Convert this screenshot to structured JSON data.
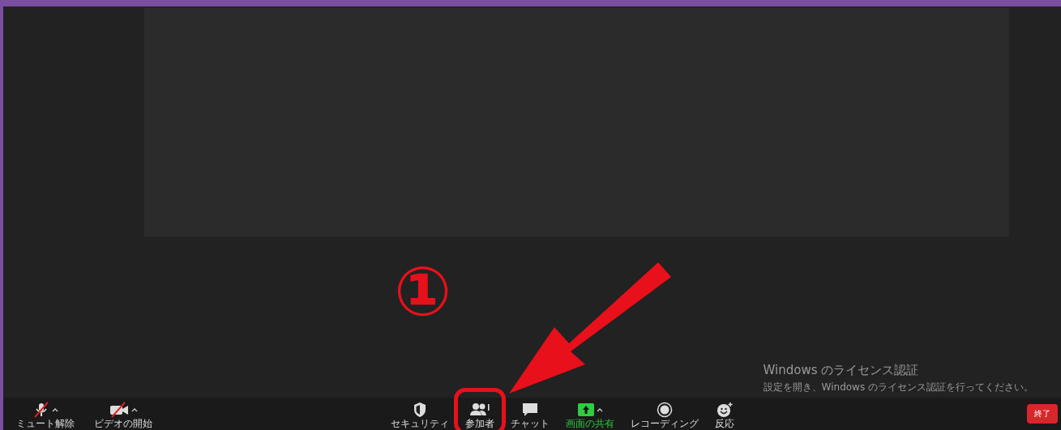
{
  "toolbar": {
    "left": [
      {
        "kind": "mic",
        "label": "ミュート解除",
        "muted": true,
        "has_menu": true
      },
      {
        "kind": "video",
        "label": "ビデオの開始",
        "muted": true,
        "has_menu": true
      }
    ],
    "center": [
      {
        "kind": "security",
        "label": "セキュリティ",
        "has_menu": false,
        "highlighted": false
      },
      {
        "kind": "participants",
        "label": "参加者",
        "has_menu": false,
        "highlighted": true
      },
      {
        "kind": "chat",
        "label": "チャット",
        "has_menu": false,
        "highlighted": false
      },
      {
        "kind": "share",
        "label": "画面の共有",
        "has_menu": true,
        "highlighted": false
      },
      {
        "kind": "record",
        "label": "レコーディング",
        "has_menu": false,
        "highlighted": false
      },
      {
        "kind": "reactions",
        "label": "反応",
        "has_menu": false,
        "highlighted": false
      }
    ],
    "end_button": "終了"
  },
  "activation_notice": {
    "title": "Windows のライセンス認証",
    "message": "設定を開き、Windows のライセンス認証を行ってください。"
  },
  "annotation": {
    "number": "①"
  }
}
